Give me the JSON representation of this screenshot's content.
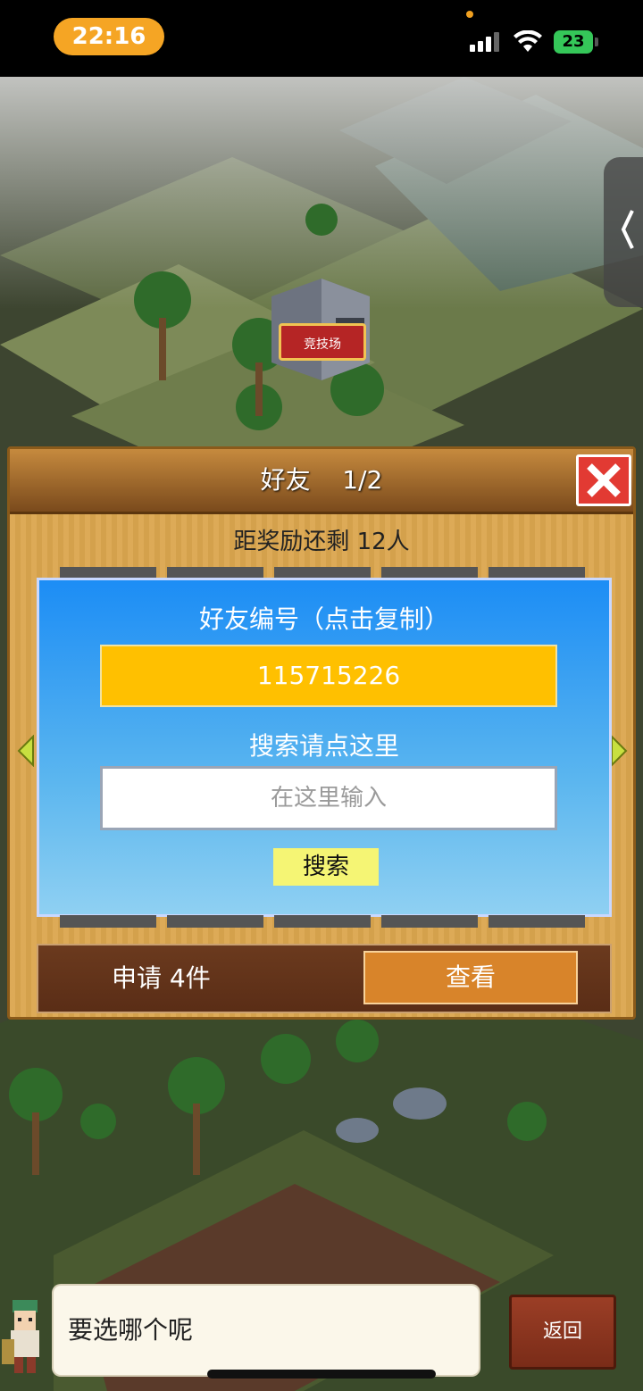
{
  "status_bar": {
    "time": "22:16",
    "battery": "23"
  },
  "map": {
    "arena_sign": "竞技场"
  },
  "friends_panel": {
    "title": "好友    1/2",
    "reward_text": "距奖励还剩 12人",
    "friend_id_label": "好友编号（点击复制）",
    "friend_id_value": "115715226",
    "search_label": "搜索请点这里",
    "search_placeholder": "在这里输入",
    "search_button": "搜索",
    "requests_text": "申请 4件",
    "view_button": "查看"
  },
  "dialog": {
    "text": "要选哪个呢",
    "back_button": "返回"
  },
  "colors": {
    "panel_bg": "#dba64e",
    "blue_box": "#1c8df5",
    "id_box": "#ffc000",
    "close_red": "#e23a33",
    "time_pill": "#f5a524",
    "battery_green": "#35c759"
  }
}
